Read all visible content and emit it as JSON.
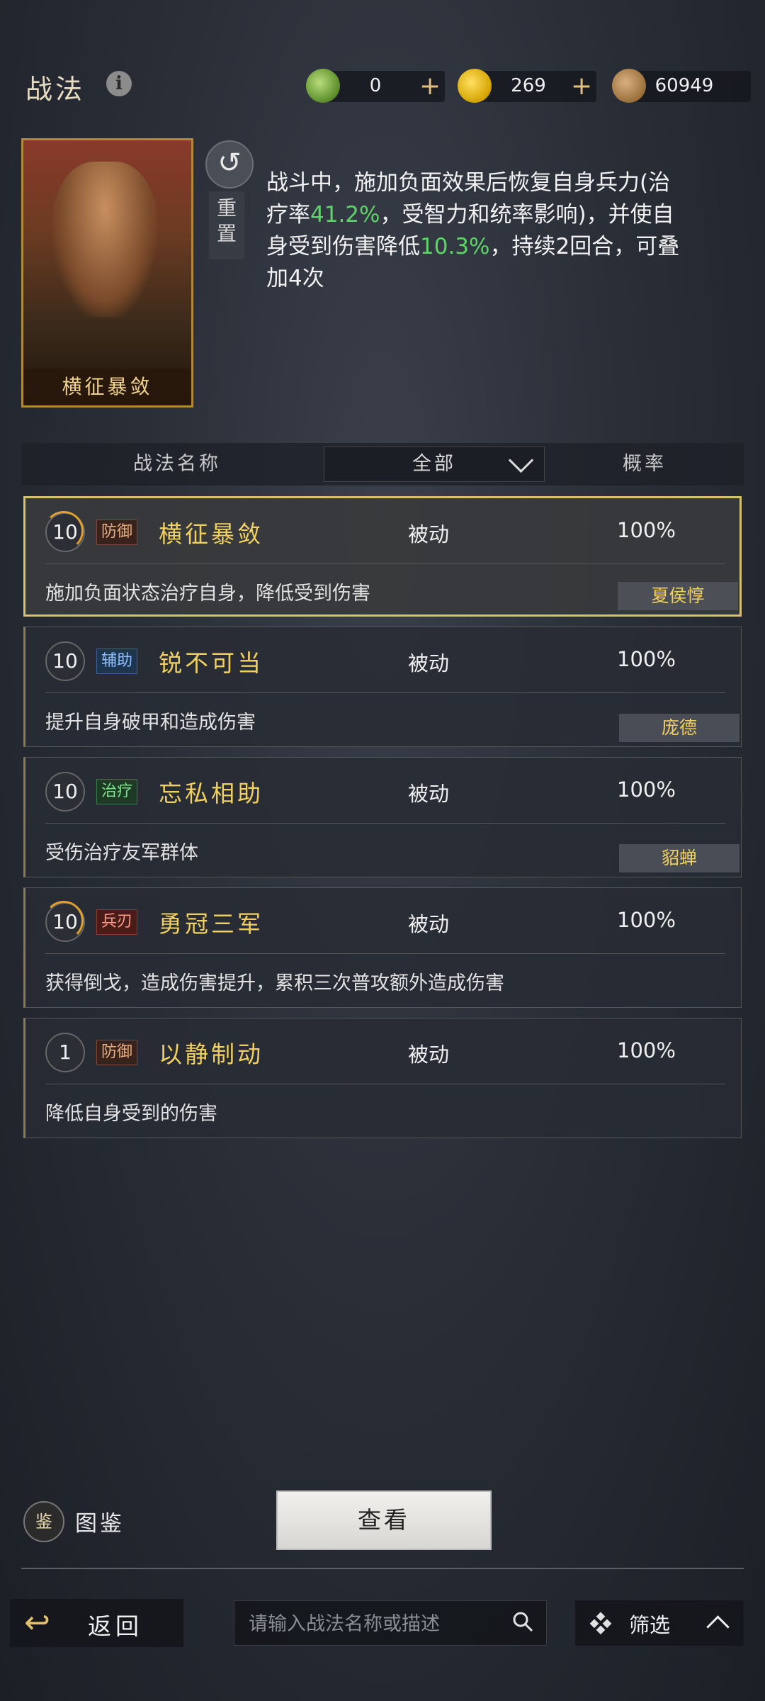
{
  "header": {
    "title": "战法",
    "currencies": [
      {
        "icon": "jade-coin-icon",
        "value": "0"
      },
      {
        "icon": "gold-coin-icon",
        "value": "269"
      },
      {
        "icon": "copper-coin-icon",
        "value": "60949"
      }
    ]
  },
  "selected": {
    "card_name": "横征暴敛",
    "reset_label": "重置",
    "desc_part1": "战斗中，施加负面效果后恢复自身兵力(治疗率",
    "heal_rate": "41.2%",
    "desc_part2": "，受智力和统率影响)，并使自身受到伤害降低",
    "dmg_reduce": "10.3%",
    "desc_part3": "，持续2回合，可叠加4次"
  },
  "table": {
    "col_name": "战法名称",
    "filter_value": "全部",
    "col_rate": "概率"
  },
  "skills": [
    {
      "level": "10",
      "tag": "防御",
      "name": "横征暴敛",
      "type": "被动",
      "rate": "100%",
      "desc": "施加负面状态治疗自身，降低受到伤害",
      "owner": "夏侯惇"
    },
    {
      "level": "10",
      "tag": "辅助",
      "name": "锐不可当",
      "type": "被动",
      "rate": "100%",
      "desc": "提升自身破甲和造成伤害",
      "owner": "庞德"
    },
    {
      "level": "10",
      "tag": "治疗",
      "name": "忘私相助",
      "type": "被动",
      "rate": "100%",
      "desc": "受伤治疗友军群体",
      "owner": "貂蝉"
    },
    {
      "level": "10",
      "tag": "兵刃",
      "name": "勇冠三军",
      "type": "被动",
      "rate": "100%",
      "desc": "获得倒戈，造成伤害提升，累积三次普攻额外造成伤害",
      "owner": ""
    },
    {
      "level": "1",
      "tag": "防御",
      "name": "以静制动",
      "type": "被动",
      "rate": "100%",
      "desc": "降低自身受到的伤害",
      "owner": ""
    }
  ],
  "bottom": {
    "atlas_icon_text": "鉴",
    "atlas_label": "图鉴",
    "view_button": "查看",
    "back_label": "返回",
    "search_placeholder": "请输入战法名称或描述",
    "filter_label": "筛选"
  },
  "colors": {
    "accent_gold": "#f0d060",
    "highlight_green": "#5ed46a",
    "selected_border": "#d7c06a"
  }
}
